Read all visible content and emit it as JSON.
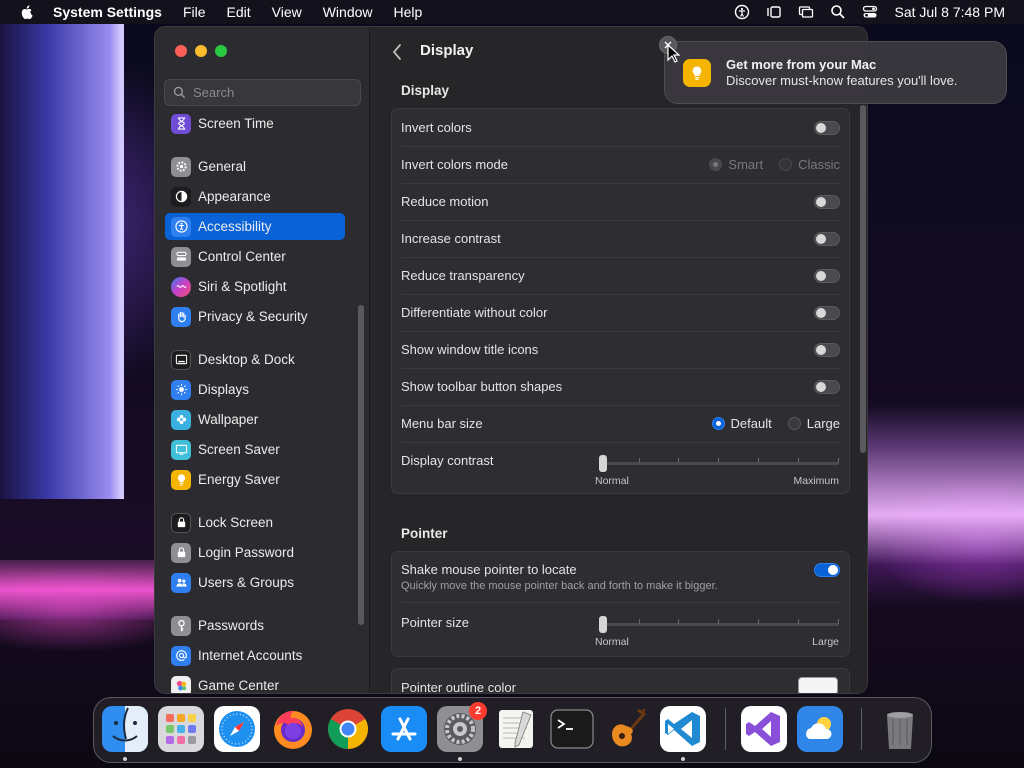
{
  "menubar": {
    "app_name": "System Settings",
    "menus": [
      "File",
      "Edit",
      "View",
      "Window",
      "Help"
    ],
    "clock": "Sat Jul 8  7:48 PM"
  },
  "sidebar": {
    "search_placeholder": "Search",
    "items": [
      {
        "label": "Screen Time",
        "icon": "hourglass-icon",
        "color": "#6e4cd6"
      },
      {
        "label": "General",
        "icon": "gear-icon",
        "color": "#8e8e93"
      },
      {
        "label": "Appearance",
        "icon": "appearance-icon",
        "color": "#1c1c1e"
      },
      {
        "label": "Accessibility",
        "icon": "accessibility-icon",
        "color": "#0a63d6"
      },
      {
        "label": "Control Center",
        "icon": "control-center-icon",
        "color": "#8e8e93"
      },
      {
        "label": "Siri & Spotlight",
        "icon": "siri-icon",
        "color": "#c940c8"
      },
      {
        "label": "Privacy & Security",
        "icon": "hand-icon",
        "color": "#2f7ff0"
      },
      {
        "label": "Desktop & Dock",
        "icon": "dock-icon",
        "color": "#1c1c1e"
      },
      {
        "label": "Displays",
        "icon": "sun-icon",
        "color": "#2f7ff0"
      },
      {
        "label": "Wallpaper",
        "icon": "flower-icon",
        "color": "#3ab0e0"
      },
      {
        "label": "Screen Saver",
        "icon": "screen-saver-icon",
        "color": "#40c0d8"
      },
      {
        "label": "Energy Saver",
        "icon": "bulb-icon",
        "color": "#f4b400"
      },
      {
        "label": "Lock Screen",
        "icon": "lock-icon",
        "color": "#1c1c1e"
      },
      {
        "label": "Login Password",
        "icon": "lock-icon",
        "color": "#8e8e93"
      },
      {
        "label": "Users & Groups",
        "icon": "users-icon",
        "color": "#2f7ff0"
      },
      {
        "label": "Passwords",
        "icon": "key-icon",
        "color": "#8e8e93"
      },
      {
        "label": "Internet Accounts",
        "icon": "at-icon",
        "color": "#2f7ff0"
      },
      {
        "label": "Game Center",
        "icon": "game-center-icon",
        "color": "#f0f0f0"
      }
    ]
  },
  "content": {
    "title": "Display",
    "display_section": "Display",
    "rows": {
      "invert_colors": {
        "label": "Invert colors",
        "on": false
      },
      "invert_mode": {
        "label": "Invert colors mode",
        "options": [
          "Smart",
          "Classic"
        ],
        "selected": "Smart"
      },
      "reduce_motion": {
        "label": "Reduce motion",
        "on": false
      },
      "increase_contrast": {
        "label": "Increase contrast",
        "on": false
      },
      "reduce_transparency": {
        "label": "Reduce transparency",
        "on": false
      },
      "differentiate": {
        "label": "Differentiate without color",
        "on": false
      },
      "title_icons": {
        "label": "Show window title icons",
        "on": false
      },
      "toolbar_shapes": {
        "label": "Show toolbar button shapes",
        "on": false
      },
      "menu_bar_size": {
        "label": "Menu bar size",
        "options": [
          "Default",
          "Large"
        ],
        "selected": "Default"
      },
      "display_contrast": {
        "label": "Display contrast",
        "min_label": "Normal",
        "max_label": "Maximum",
        "value": 0
      }
    },
    "pointer_section": "Pointer",
    "pointer": {
      "shake": {
        "label": "Shake mouse pointer to locate",
        "description": "Quickly move the mouse pointer back and forth to make it bigger.",
        "on": true
      },
      "size": {
        "label": "Pointer size",
        "min_label": "Normal",
        "max_label": "Large",
        "value": 0
      },
      "outline": {
        "label": "Pointer outline color",
        "color": "#f5f5f5"
      }
    }
  },
  "notification": {
    "title": "Get more from your Mac",
    "body": "Discover must-know features you'll love."
  },
  "dock": {
    "settings_badge": "2"
  }
}
